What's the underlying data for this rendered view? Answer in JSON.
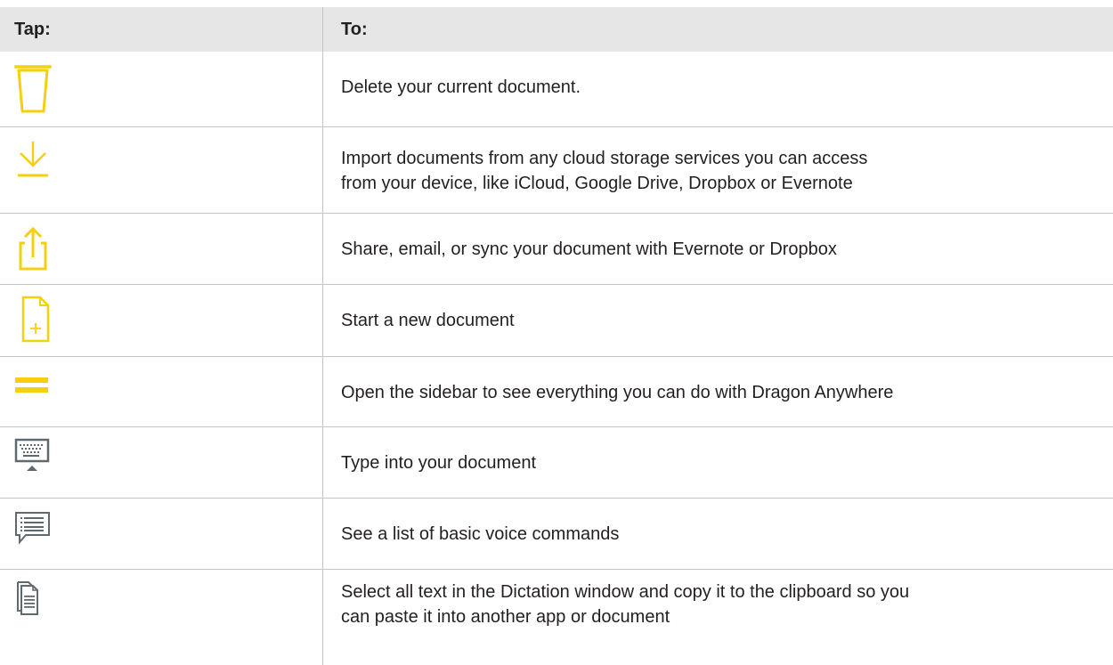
{
  "table": {
    "headers": {
      "tap": "Tap:",
      "to": "To:"
    },
    "rows": [
      {
        "icon": "trash-icon",
        "lines": [
          "Delete your current document."
        ]
      },
      {
        "icon": "import-download-icon",
        "lines": [
          "Import documents from any cloud storage services you can access",
          "from your device, like iCloud, Google Drive, Dropbox or Evernote"
        ]
      },
      {
        "icon": "share-icon",
        "lines": [
          "Share, email, or sync your document with Evernote or Dropbox"
        ]
      },
      {
        "icon": "new-document-icon",
        "lines": [
          "Start a new document"
        ]
      },
      {
        "icon": "menu-icon",
        "lines": [
          "Open the sidebar to see everything you can do with Dragon Anywhere"
        ]
      },
      {
        "icon": "keyboard-icon",
        "lines": [
          "Type into your document"
        ]
      },
      {
        "icon": "voice-commands-list-icon",
        "lines": [
          "See a list of basic voice commands"
        ]
      },
      {
        "icon": "copy-all-icon",
        "lines": [
          "Select all text in the Dictation window and copy it to the clipboard so you",
          "can paste it into another app or document"
        ]
      }
    ]
  },
  "colors": {
    "accent_yellow": "#f6cf0e",
    "icon_gray": "#5f6a70",
    "header_bg": "#e6e6e6",
    "rule": "#c4c4c4"
  }
}
